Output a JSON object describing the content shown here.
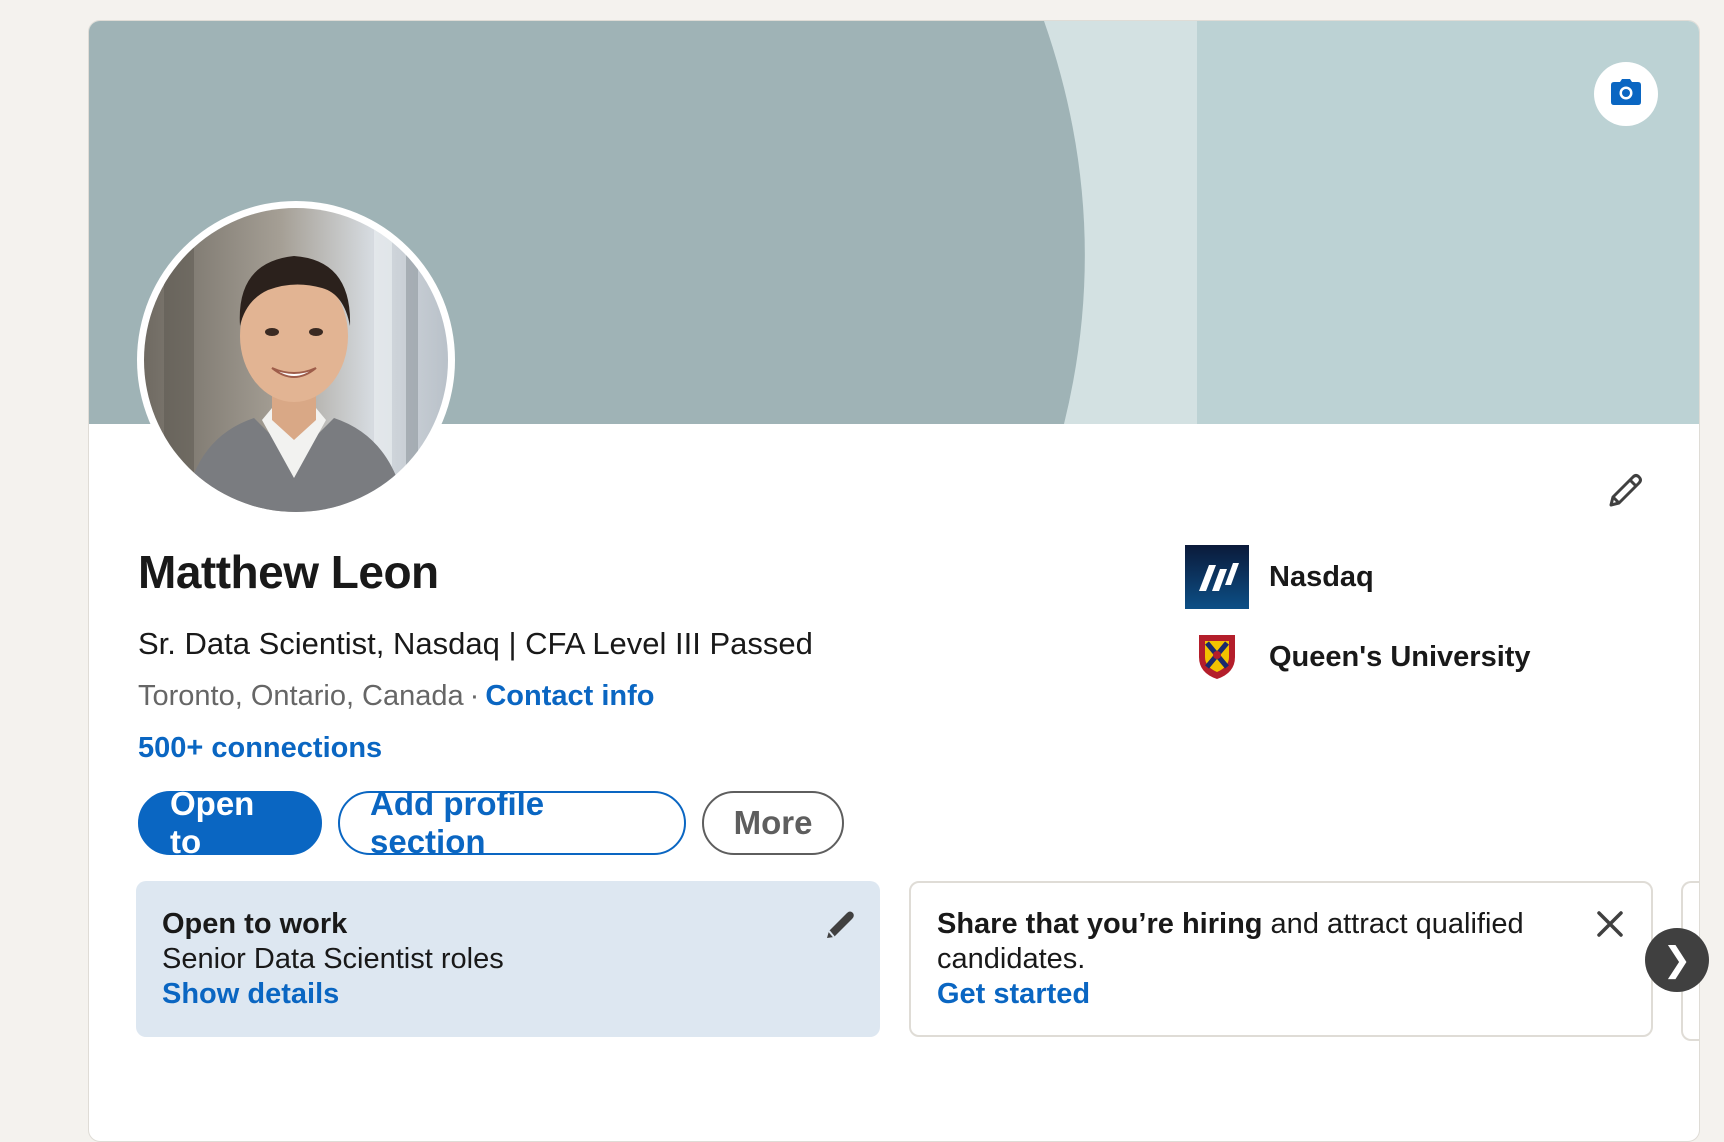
{
  "profile": {
    "name": "Matthew Leon",
    "headline": "Sr. Data Scientist, Nasdaq | CFA Level III Passed",
    "location": "Toronto, Ontario, Canada",
    "separator": "·",
    "contact_info_label": "Contact info",
    "connections_label": "500+ connections"
  },
  "actions": {
    "open_to_label": "Open to",
    "add_section_label": "Add profile section",
    "more_label": "More"
  },
  "organizations": [
    {
      "name": "Nasdaq",
      "icon": "nasdaq-logo"
    },
    {
      "name": "Queen's University",
      "icon": "queens-university-crest"
    }
  ],
  "open_to_work": {
    "title": "Open to work",
    "roles": "Senior Data Scientist roles",
    "link_label": "Show details"
  },
  "hiring_prompt": {
    "bold_text": "Share that you’re hiring",
    "rest_text": " and attract qualified candidates.",
    "link_label": "Get started"
  },
  "carousel": {
    "next_glyph": "❯"
  },
  "colors": {
    "accent": "#0a66c2",
    "banner_primary": "#9fb3b6",
    "banner_light": "#bcd2d4",
    "banner_strip": "#d3e1e2",
    "open_to_work_bg": "#dde7f1"
  },
  "icons": [
    "camera-icon",
    "pencil-icon",
    "close-icon",
    "chevron-right-icon"
  ]
}
